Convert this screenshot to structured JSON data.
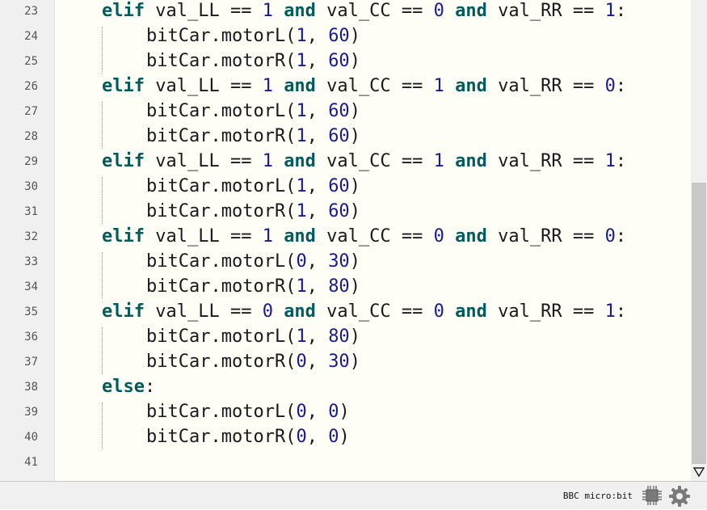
{
  "editor": {
    "lines": [
      {
        "number": "23",
        "tokens": [
          {
            "text": "elif",
            "kind": "kw"
          },
          {
            "text": " val_LL == "
          },
          {
            "text": "1",
            "kind": "num"
          },
          {
            "text": " "
          },
          {
            "text": "and",
            "kind": "kw"
          },
          {
            "text": " val_CC == "
          },
          {
            "text": "0",
            "kind": "num"
          },
          {
            "text": " "
          },
          {
            "text": "and",
            "kind": "kw"
          },
          {
            "text": " val_RR == "
          },
          {
            "text": "1",
            "kind": "num"
          },
          {
            "text": ":"
          }
        ]
      },
      {
        "number": "24",
        "tokens": [
          {
            "text": "bitCar.motorL("
          },
          {
            "text": "1",
            "kind": "num"
          },
          {
            "text": ", "
          },
          {
            "text": "60",
            "kind": "num"
          },
          {
            "text": ")"
          }
        ]
      },
      {
        "number": "25",
        "tokens": [
          {
            "text": "bitCar.motorR("
          },
          {
            "text": "1",
            "kind": "num"
          },
          {
            "text": ", "
          },
          {
            "text": "60",
            "kind": "num"
          },
          {
            "text": ")"
          }
        ]
      },
      {
        "number": "26",
        "tokens": [
          {
            "text": "elif",
            "kind": "kw"
          },
          {
            "text": " val_LL == "
          },
          {
            "text": "1",
            "kind": "num"
          },
          {
            "text": " "
          },
          {
            "text": "and",
            "kind": "kw"
          },
          {
            "text": " val_CC == "
          },
          {
            "text": "1",
            "kind": "num"
          },
          {
            "text": " "
          },
          {
            "text": "and",
            "kind": "kw"
          },
          {
            "text": " val_RR == "
          },
          {
            "text": "0",
            "kind": "num"
          },
          {
            "text": ":"
          }
        ]
      },
      {
        "number": "27",
        "tokens": [
          {
            "text": "bitCar.motorL("
          },
          {
            "text": "1",
            "kind": "num"
          },
          {
            "text": ", "
          },
          {
            "text": "60",
            "kind": "num"
          },
          {
            "text": ")"
          }
        ]
      },
      {
        "number": "28",
        "tokens": [
          {
            "text": "bitCar.motorR("
          },
          {
            "text": "1",
            "kind": "num"
          },
          {
            "text": ", "
          },
          {
            "text": "60",
            "kind": "num"
          },
          {
            "text": ")"
          }
        ]
      },
      {
        "number": "29",
        "tokens": [
          {
            "text": "elif",
            "kind": "kw"
          },
          {
            "text": " val_LL == "
          },
          {
            "text": "1",
            "kind": "num"
          },
          {
            "text": " "
          },
          {
            "text": "and",
            "kind": "kw"
          },
          {
            "text": " val_CC == "
          },
          {
            "text": "1",
            "kind": "num"
          },
          {
            "text": " "
          },
          {
            "text": "and",
            "kind": "kw"
          },
          {
            "text": " val_RR == "
          },
          {
            "text": "1",
            "kind": "num"
          },
          {
            "text": ":"
          }
        ]
      },
      {
        "number": "30",
        "tokens": [
          {
            "text": "bitCar.motorL("
          },
          {
            "text": "1",
            "kind": "num"
          },
          {
            "text": ", "
          },
          {
            "text": "60",
            "kind": "num"
          },
          {
            "text": ")"
          }
        ]
      },
      {
        "number": "31",
        "tokens": [
          {
            "text": "bitCar.motorR("
          },
          {
            "text": "1",
            "kind": "num"
          },
          {
            "text": ", "
          },
          {
            "text": "60",
            "kind": "num"
          },
          {
            "text": ")"
          }
        ]
      },
      {
        "number": "32",
        "tokens": [
          {
            "text": "elif",
            "kind": "kw"
          },
          {
            "text": " val_LL == "
          },
          {
            "text": "1",
            "kind": "num"
          },
          {
            "text": " "
          },
          {
            "text": "and",
            "kind": "kw"
          },
          {
            "text": " val_CC == "
          },
          {
            "text": "0",
            "kind": "num"
          },
          {
            "text": " "
          },
          {
            "text": "and",
            "kind": "kw"
          },
          {
            "text": " val_RR == "
          },
          {
            "text": "0",
            "kind": "num"
          },
          {
            "text": ":"
          }
        ]
      },
      {
        "number": "33",
        "tokens": [
          {
            "text": "bitCar.motorL("
          },
          {
            "text": "0",
            "kind": "num"
          },
          {
            "text": ", "
          },
          {
            "text": "30",
            "kind": "num"
          },
          {
            "text": ")"
          }
        ]
      },
      {
        "number": "34",
        "tokens": [
          {
            "text": "bitCar.motorR("
          },
          {
            "text": "1",
            "kind": "num"
          },
          {
            "text": ", "
          },
          {
            "text": "80",
            "kind": "num"
          },
          {
            "text": ")"
          }
        ]
      },
      {
        "number": "35",
        "tokens": [
          {
            "text": "elif",
            "kind": "kw"
          },
          {
            "text": " val_LL == "
          },
          {
            "text": "0",
            "kind": "num"
          },
          {
            "text": " "
          },
          {
            "text": "and",
            "kind": "kw"
          },
          {
            "text": " val_CC == "
          },
          {
            "text": "0",
            "kind": "num"
          },
          {
            "text": " "
          },
          {
            "text": "and",
            "kind": "kw"
          },
          {
            "text": " val_RR == "
          },
          {
            "text": "1",
            "kind": "num"
          },
          {
            "text": ":"
          }
        ]
      },
      {
        "number": "36",
        "tokens": [
          {
            "text": "bitCar.motorL("
          },
          {
            "text": "1",
            "kind": "num"
          },
          {
            "text": ", "
          },
          {
            "text": "80",
            "kind": "num"
          },
          {
            "text": ")"
          }
        ]
      },
      {
        "number": "37",
        "tokens": [
          {
            "text": "bitCar.motorR("
          },
          {
            "text": "0",
            "kind": "num"
          },
          {
            "text": ", "
          },
          {
            "text": "30",
            "kind": "num"
          },
          {
            "text": ")"
          }
        ]
      },
      {
        "number": "38",
        "tokens": [
          {
            "text": "else",
            "kind": "kw"
          },
          {
            "text": ":"
          }
        ]
      },
      {
        "number": "39",
        "tokens": [
          {
            "text": "bitCar.motorL("
          },
          {
            "text": "0",
            "kind": "num"
          },
          {
            "text": ", "
          },
          {
            "text": "0",
            "kind": "num"
          },
          {
            "text": ")"
          }
        ]
      },
      {
        "number": "40",
        "tokens": [
          {
            "text": "bitCar.motorR("
          },
          {
            "text": "0",
            "kind": "num"
          },
          {
            "text": ", "
          },
          {
            "text": "0",
            "kind": "num"
          },
          {
            "text": ")"
          }
        ]
      },
      {
        "number": "41",
        "tokens": []
      }
    ]
  },
  "statusbar": {
    "board_label": "BBC micro:bit",
    "chip_icon": "chip-icon",
    "settings_icon": "gear-icon"
  },
  "colors": {
    "keyword": "#005c5c",
    "number": "#1a1a8c",
    "text": "#1a1a1a",
    "background": "#fefef6"
  }
}
